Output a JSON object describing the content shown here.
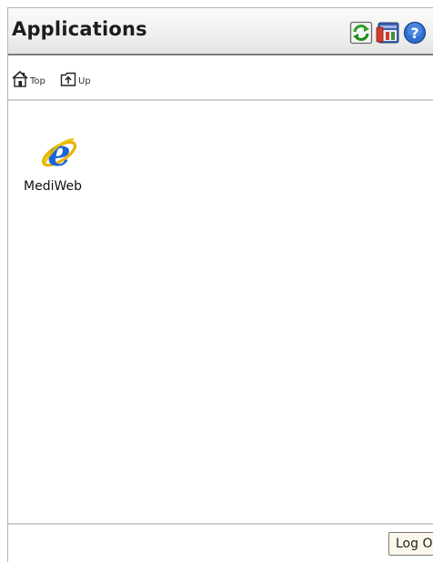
{
  "header": {
    "title": "Applications",
    "icons": [
      "refresh-icon",
      "preferences-icon",
      "help-icon"
    ]
  },
  "toolbar": {
    "top_label": "Top",
    "up_label": "Up"
  },
  "apps": [
    {
      "label": "MediWeb",
      "icon": "internet-explorer-icon"
    }
  ],
  "footer": {
    "logoff_label": "Log Off"
  },
  "colors": {
    "header_border": "#7c7c7c",
    "separator": "#cfcfcf",
    "button_bg": "#fbf7ea",
    "ie_blue": "#1a64d8",
    "ie_ring": "#e8b400"
  }
}
